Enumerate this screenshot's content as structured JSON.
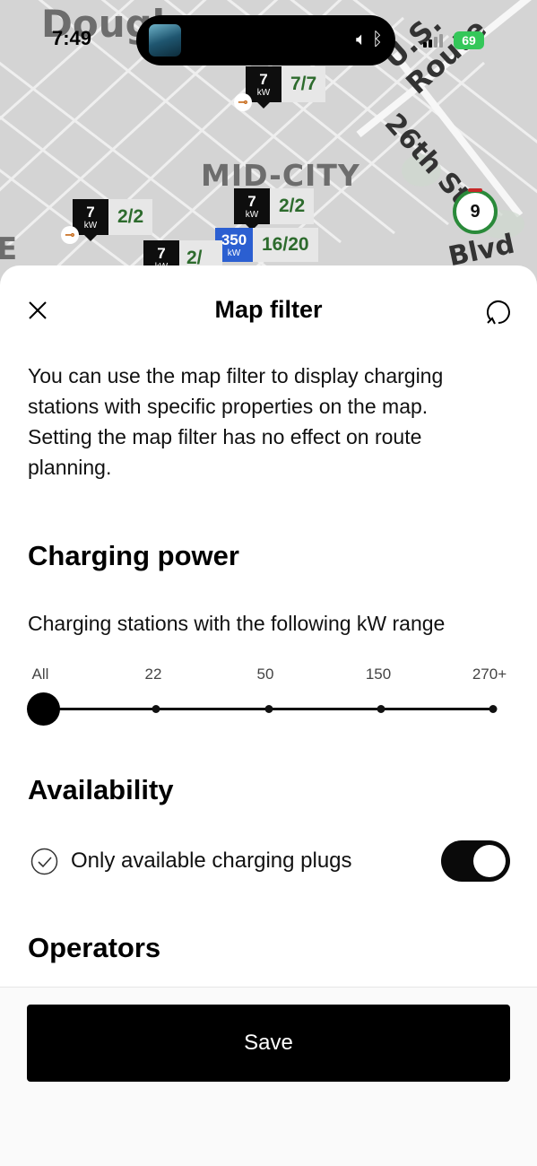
{
  "status_bar": {
    "time": "7:49",
    "battery": "69"
  },
  "map": {
    "labels": {
      "neighborhood_top": "Dougl",
      "district": "MID-CITY",
      "edge": "E",
      "route": "U.S. Route",
      "street": "26th St",
      "boulevard": "Blvd"
    },
    "route_shield": "9",
    "markers": [
      {
        "power": "7",
        "unit": "kW",
        "count": "7/7"
      },
      {
        "power": "7",
        "unit": "kW",
        "count": "2/2"
      },
      {
        "power": "7",
        "unit": "kW",
        "count": "2/2"
      },
      {
        "power": "350",
        "unit": "kW",
        "count": "16/20"
      },
      {
        "power": "7",
        "unit": "kW",
        "count": "2/"
      }
    ],
    "colors": {
      "marker_dark": "#0e0e0e",
      "marker_fast": "#2b5fd1",
      "available_text": "#2d6b2d",
      "plug": "#c76a1a"
    }
  },
  "sheet": {
    "title": "Map filter",
    "close_icon": "close-icon",
    "reset_icon": "reset-icon",
    "intro": "You can use the map filter to display charging stations with specific properties on the map. Setting the map filter has no effect on route planning.",
    "charging_power": {
      "title": "Charging power",
      "caption": "Charging stations with the following kW range",
      "ticks": [
        "All",
        "22",
        "50",
        "150",
        "270+"
      ],
      "selected": "All"
    },
    "availability": {
      "title": "Availability",
      "option_label": "Only available charging plugs",
      "enabled": true
    },
    "operators": {
      "title": "Operators"
    },
    "save_label": "Save"
  }
}
